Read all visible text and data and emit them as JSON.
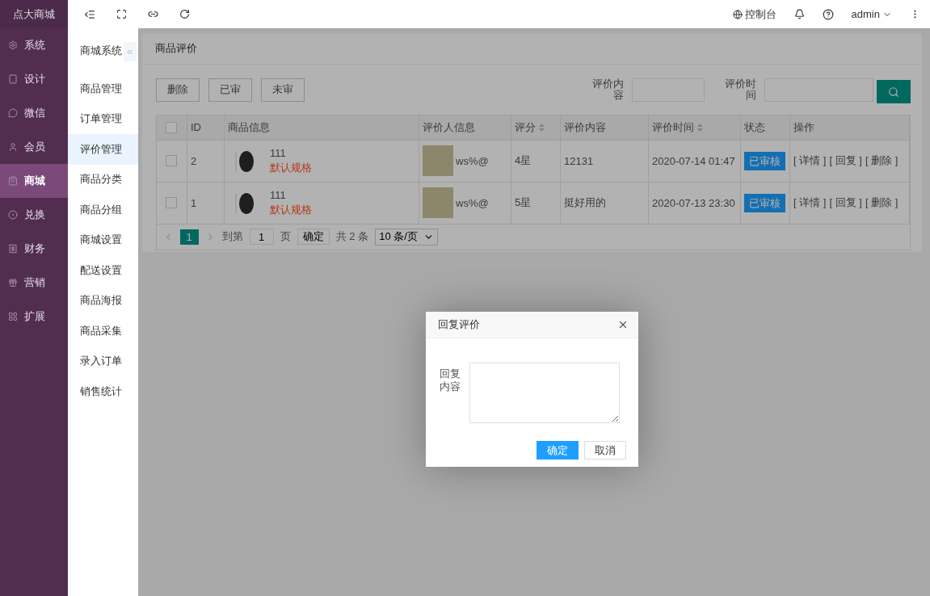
{
  "brand": "点大商城",
  "nav": [
    {
      "label": "系统",
      "selected": false
    },
    {
      "label": "设计",
      "selected": false
    },
    {
      "label": "微信",
      "selected": false
    },
    {
      "label": "会员",
      "selected": false
    },
    {
      "label": "商城",
      "selected": true
    },
    {
      "label": "兑换",
      "selected": false
    },
    {
      "label": "财务",
      "selected": false
    },
    {
      "label": "营销",
      "selected": false
    },
    {
      "label": "扩展",
      "selected": false
    }
  ],
  "submenu": {
    "title": "商城系统",
    "items": [
      {
        "label": "商品管理",
        "selected": false
      },
      {
        "label": "订单管理",
        "selected": false
      },
      {
        "label": "评价管理",
        "selected": true
      },
      {
        "label": "商品分类",
        "selected": false
      },
      {
        "label": "商品分组",
        "selected": false
      },
      {
        "label": "商城设置",
        "selected": false
      },
      {
        "label": "配送设置",
        "selected": false
      },
      {
        "label": "商品海报",
        "selected": false
      },
      {
        "label": "商品采集",
        "selected": false
      },
      {
        "label": "录入订单",
        "selected": false
      },
      {
        "label": "销售统计",
        "selected": false
      }
    ]
  },
  "topbar": {
    "console": "控制台",
    "user": "admin"
  },
  "page_title": "商品评价",
  "toolbar_buttons": [
    "删除",
    "已审",
    "未审"
  ],
  "filters": [
    {
      "label": "评价内容"
    },
    {
      "label": "评价时间"
    }
  ],
  "table": {
    "columns": [
      {
        "label": "ID",
        "sortable": false
      },
      {
        "label": "商品信息",
        "sortable": false
      },
      {
        "label": "评价人信息",
        "sortable": false
      },
      {
        "label": "评分",
        "sortable": true
      },
      {
        "label": "评价内容",
        "sortable": false
      },
      {
        "label": "评价时间",
        "sortable": true
      },
      {
        "label": "状态",
        "sortable": false
      },
      {
        "label": "操作",
        "sortable": false
      }
    ],
    "header_checked": false,
    "rows": [
      {
        "checked": false,
        "id": "2",
        "product": "111",
        "spec": "默认规格",
        "reviewer": "ws%@",
        "rating": "4星",
        "content": "12131",
        "time": "2020-07-14 01:47",
        "status": "已审核",
        "actions": [
          "[ 详情 ]",
          "[ 回复 ]",
          "[ 删除 ]"
        ]
      },
      {
        "checked": false,
        "id": "1",
        "product": "111",
        "spec": "默认规格",
        "reviewer": "ws%@",
        "rating": "5星",
        "content": "挺好用的",
        "time": "2020-07-13 23:30",
        "status": "已审核",
        "actions": [
          "[ 详情 ]",
          "[ 回复 ]",
          "[ 删除 ]"
        ]
      }
    ]
  },
  "pagination": {
    "pages": [
      {
        "label": "1",
        "selected": true
      }
    ],
    "goto": "到第",
    "page_input": "1",
    "page_unit": "页",
    "confirm": "确定",
    "total": "共 2 条",
    "page_size": "10 条/页"
  },
  "dialog": {
    "title": "回复评价",
    "field_label": "回复内容",
    "buttons": [
      {
        "label": "确定",
        "kind": "primary"
      },
      {
        "label": "取消",
        "kind": "secondary"
      }
    ]
  }
}
